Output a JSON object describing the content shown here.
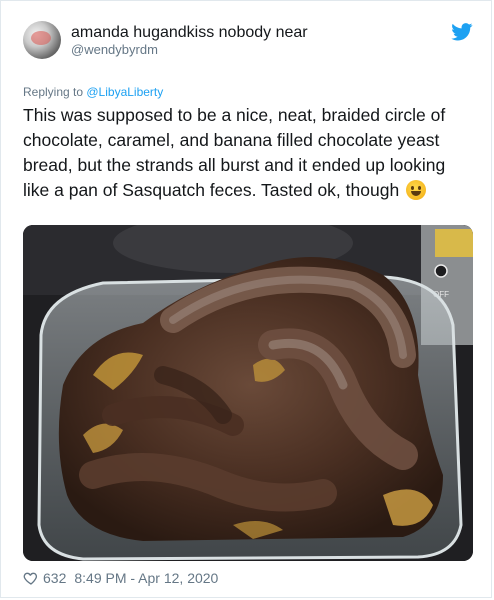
{
  "tweet": {
    "display_name": "amanda hugandkiss nobody near",
    "handle": "@wendybyrdm",
    "reply_prefix": "Replying to ",
    "reply_to": "@LibyaLiberty",
    "text": "This was supposed to be a nice, neat, braided circle of chocolate, caramel, and banana filled chocolate yeast bread, but the strands all burst and it ended up looking like a pan of Sasquatch feces. Tasted ok, though",
    "emoji": "grinning-face-emoji",
    "likes": "632",
    "timestamp": "8:49 PM - Apr 12, 2020"
  },
  "photo": {
    "subject": "burst-chocolate-braided-bread-in-glass-pan",
    "stove_labels": [
      "OFF"
    ]
  },
  "colors": {
    "accent": "#1da1f2",
    "text": "#14171a",
    "secondary": "#657786",
    "border": "#e1e8ed"
  }
}
